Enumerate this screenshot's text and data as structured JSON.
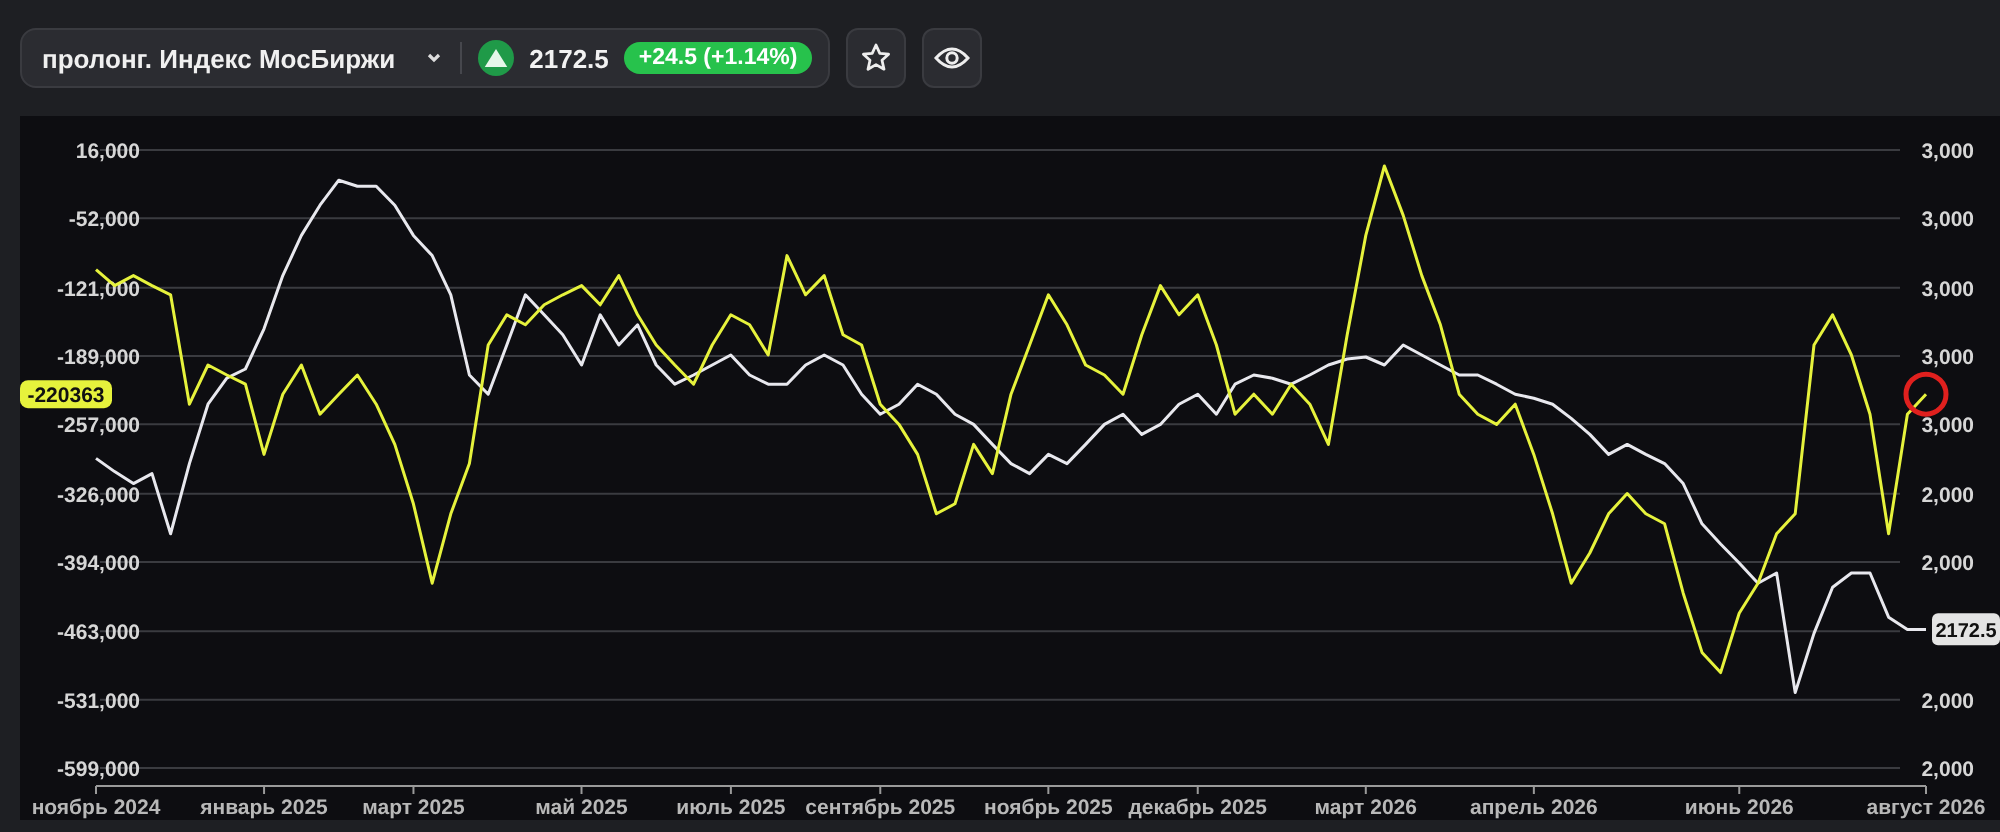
{
  "header": {
    "instrument": "пролонг. Индекс МосБиржи",
    "rising": true,
    "price": "2172.5",
    "change": "+24.5 (+1.14%)"
  },
  "chart": {
    "chart_data": {
      "type": "line",
      "grid": true,
      "ylim": [
        -599000,
        16000
      ],
      "categories": [
        "ноябрь 2024",
        null,
        null,
        null,
        null,
        null,
        null,
        null,
        null,
        "январь 2025",
        null,
        null,
        null,
        null,
        null,
        null,
        null,
        "март 2025",
        null,
        null,
        null,
        null,
        null,
        null,
        null,
        null,
        "май 2025",
        null,
        null,
        null,
        null,
        null,
        null,
        null,
        "июль 2025",
        null,
        null,
        null,
        null,
        null,
        null,
        null,
        "сентябрь 2025",
        null,
        null,
        null,
        null,
        null,
        null,
        null,
        null,
        "ноябрь 2025",
        null,
        null,
        null,
        null,
        null,
        null,
        null,
        "декабрь 2025",
        null,
        null,
        null,
        null,
        null,
        null,
        null,
        null,
        "март 2026",
        null,
        null,
        null,
        null,
        null,
        null,
        null,
        null,
        "апрель 2026",
        null,
        null,
        null,
        null,
        null,
        null,
        null,
        null,
        null,
        null,
        "июнь 2026",
        null,
        null,
        null,
        null,
        null,
        null,
        null,
        null,
        null,
        "август 2026"
      ],
      "yticks": [
        {
          "value": 16000,
          "label": "16,000"
        },
        {
          "value": -52000,
          "label": "-52,000"
        },
        {
          "value": -121000,
          "label": "-121,000"
        },
        {
          "value": -189000,
          "label": "-189,000"
        },
        {
          "value": -257000,
          "label": "-257,000"
        },
        {
          "value": -326000,
          "label": "-326,000"
        },
        {
          "value": -394000,
          "label": "-394,000"
        },
        {
          "value": -463000,
          "label": "-463,000"
        },
        {
          "value": -531000,
          "label": "-531,000"
        },
        {
          "value": -599000,
          "label": "-599,000"
        }
      ],
      "series": [
        {
          "color": "#e6f23c",
          "values": [
            -103000,
            -119000,
            -109000,
            -119000,
            -128000,
            -237000,
            -198000,
            -208000,
            -217000,
            -287000,
            -227000,
            -198000,
            -247000,
            -227000,
            -208000,
            -237000,
            -277000,
            -336000,
            -415000,
            -346000,
            -296000,
            -178000,
            -148000,
            -158000,
            -138000,
            -128000,
            -119000,
            -138000,
            -109000,
            -148000,
            -178000,
            -198000,
            -217000,
            -178000,
            -148000,
            -158000,
            -188000,
            -89000,
            -128000,
            -109000,
            -168000,
            -178000,
            -237000,
            -257000,
            -287000,
            -346000,
            -336000,
            -277000,
            -306000,
            -227000,
            -178000,
            -128000,
            -158000,
            -198000,
            -208000,
            -227000,
            -168000,
            -119000,
            -148000,
            -128000,
            -178000,
            -247000,
            -227000,
            -247000,
            -217000,
            -237000,
            -277000,
            -168000,
            -69000,
            0,
            -49000,
            -109000,
            -158000,
            -227000,
            -247000,
            -257000,
            -237000,
            -287000,
            -346000,
            -415000,
            -385000,
            -346000,
            -326000,
            -346000,
            -356000,
            -425000,
            -484000,
            -504000,
            -445000,
            -415000,
            -366000,
            -346000,
            -178000,
            -148000,
            -188000,
            -247000,
            -366000,
            -247000,
            -227000
          ]
        },
        {
          "color": "#e8e8ee",
          "values": [
            -291000,
            -304000,
            -316000,
            -306000,
            -366000,
            -296000,
            -237000,
            -211000,
            -202000,
            -162000,
            -109000,
            -69000,
            -39000,
            -14000,
            -20000,
            -20000,
            -39000,
            -69000,
            -89000,
            -128000,
            -208000,
            -227000,
            -178000,
            -128000,
            -148000,
            -168000,
            -198000,
            -148000,
            -178000,
            -158000,
            -198000,
            -217000,
            -208000,
            -198000,
            -188000,
            -208000,
            -217000,
            -217000,
            -198000,
            -188000,
            -198000,
            -227000,
            -247000,
            -237000,
            -217000,
            -227000,
            -247000,
            -257000,
            -277000,
            -296000,
            -306000,
            -287000,
            -296000,
            -277000,
            -257000,
            -247000,
            -267000,
            -257000,
            -237000,
            -227000,
            -247000,
            -217000,
            -208000,
            -211000,
            -217000,
            -208000,
            -198000,
            -192000,
            -190000,
            -198000,
            -178000,
            -188000,
            -198000,
            -208000,
            -208000,
            -217000,
            -227000,
            -231000,
            -237000,
            -251000,
            -267000,
            -287000,
            -277000,
            -287000,
            -296000,
            -316000,
            -356000,
            -376000,
            -395000,
            -415000,
            -405000,
            -524000,
            -465000,
            -419000,
            -405000,
            -405000,
            -449000,
            -461000,
            -461000
          ]
        }
      ]
    },
    "left_label": "-220363",
    "right_axis": [
      "3,000",
      "3,000",
      "3,000",
      "3,000",
      "3,000",
      "2,000",
      "2,000",
      "2,000",
      "2,000"
    ],
    "price_label": "2172.5"
  }
}
